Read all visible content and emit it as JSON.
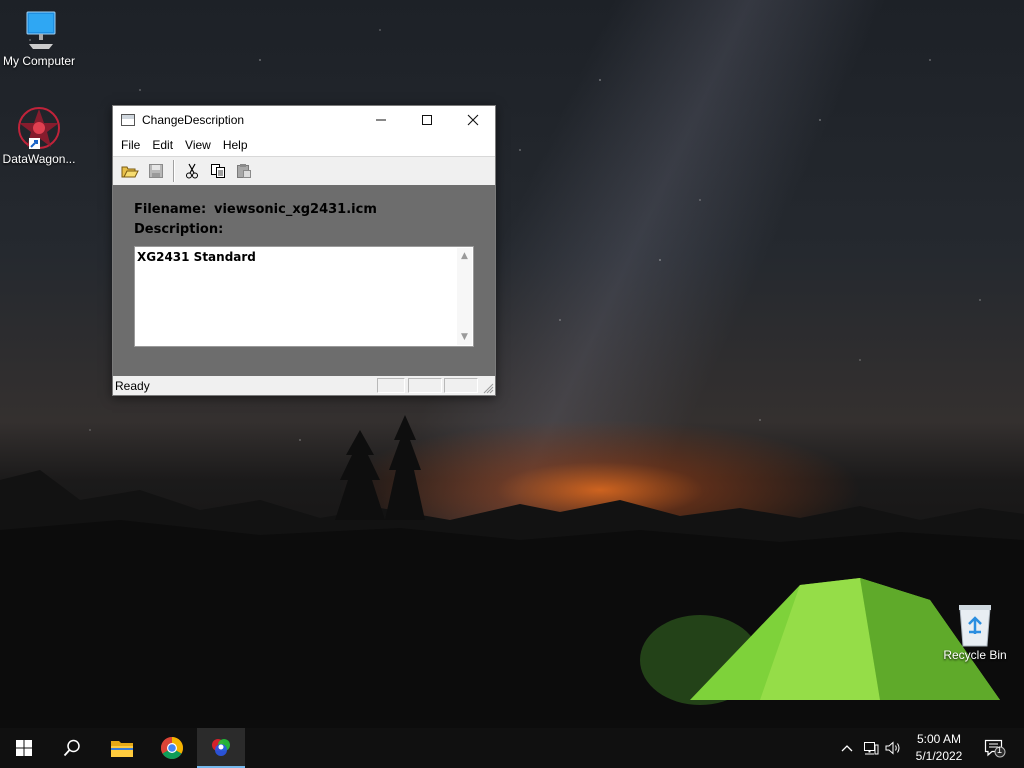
{
  "desktop": {
    "icons": [
      {
        "label": "My Computer",
        "icon": "computer-icon"
      },
      {
        "label": "DataWagon...",
        "icon": "datawagon-shortcut-icon"
      },
      {
        "label": "Recycle Bin",
        "icon": "recycle-bin-icon"
      }
    ]
  },
  "window": {
    "title": "ChangeDescription",
    "controls": {
      "minimize": "minimize-icon",
      "maximize": "maximize-icon",
      "close": "close-icon"
    },
    "menu": [
      "File",
      "Edit",
      "View",
      "Help"
    ],
    "toolbar": [
      "open-folder-icon",
      "save-icon",
      "cut-icon",
      "copy-icon",
      "paste-icon"
    ],
    "filename_label": "Filename:",
    "filename_value": "viewsonic_xg2431.icm",
    "description_label": "Description:",
    "description_value": "XG2431 Standard",
    "status": "Ready"
  },
  "taskbar": {
    "items": [
      "start-icon",
      "search-icon",
      "file-explorer-icon",
      "chrome-icon",
      "color-app-icon"
    ],
    "active_item": "color-app-icon",
    "time": "5:00 AM",
    "date": "5/1/2022",
    "notification_count": "1"
  },
  "colors": {
    "taskbar": "#101010",
    "client_background": "#6d6d6d",
    "active_indicator": "#76b9ed"
  }
}
